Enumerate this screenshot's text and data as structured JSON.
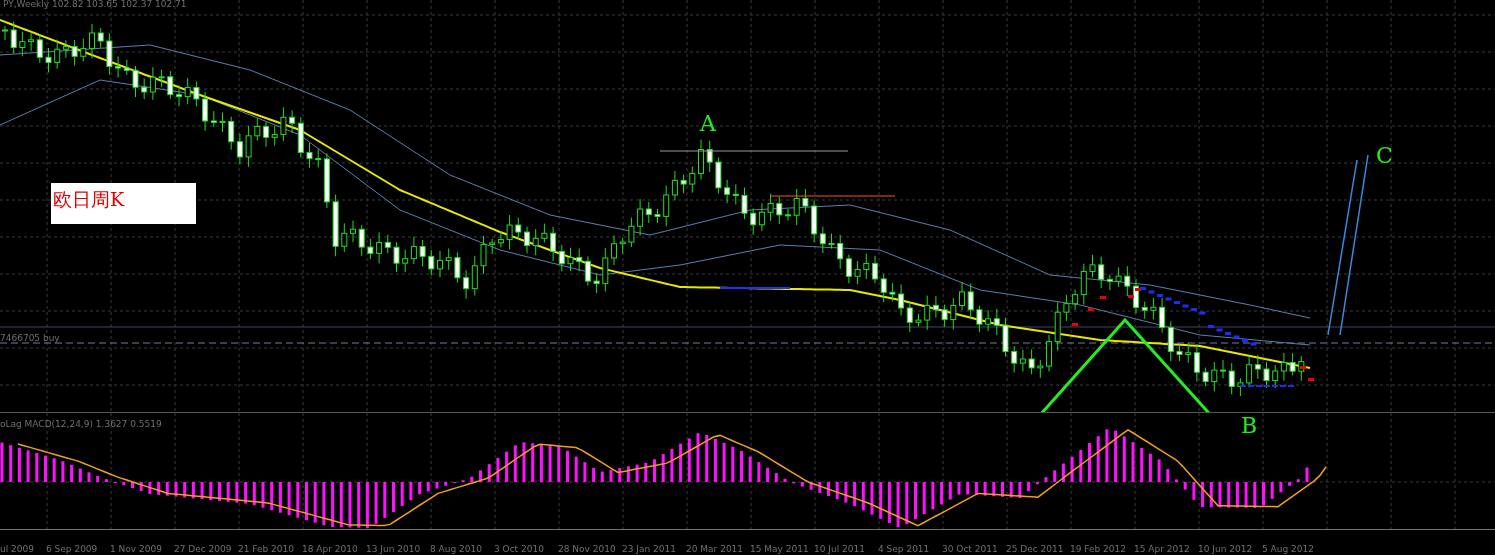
{
  "chart": {
    "title": "PY,Weekly  102.82 103.65 102.37 102.71"
  },
  "price_line": {
    "label": "7466705 buy"
  },
  "note": {
    "text": "欧日周K"
  },
  "annotations": [
    {
      "text": "A"
    },
    {
      "text": "B"
    },
    {
      "text": "C"
    }
  ],
  "indicator": {
    "label": "oLag MACD(12,24,9) 1.3627 0.5519"
  },
  "x_axis": {
    "dates": [
      "ul 2009",
      "6 Sep 2009",
      "1 Nov 2009",
      "27 Dec 2009",
      "21 Feb 2010",
      "18 Apr 2010",
      "13 Jun 2010",
      "8 Aug 2010",
      "3 Oct 2010",
      "28 Nov 2010",
      "23 Jan 2011",
      "20 Mar 2011",
      "15 May 2011",
      "10 Jul 2011",
      "4 Sep 2011",
      "30 Oct 2011",
      "25 Dec 2011",
      "19 Feb 2012",
      "15 Apr 2012",
      "10 Jun 2012",
      "5 Aug 2012"
    ]
  }
}
